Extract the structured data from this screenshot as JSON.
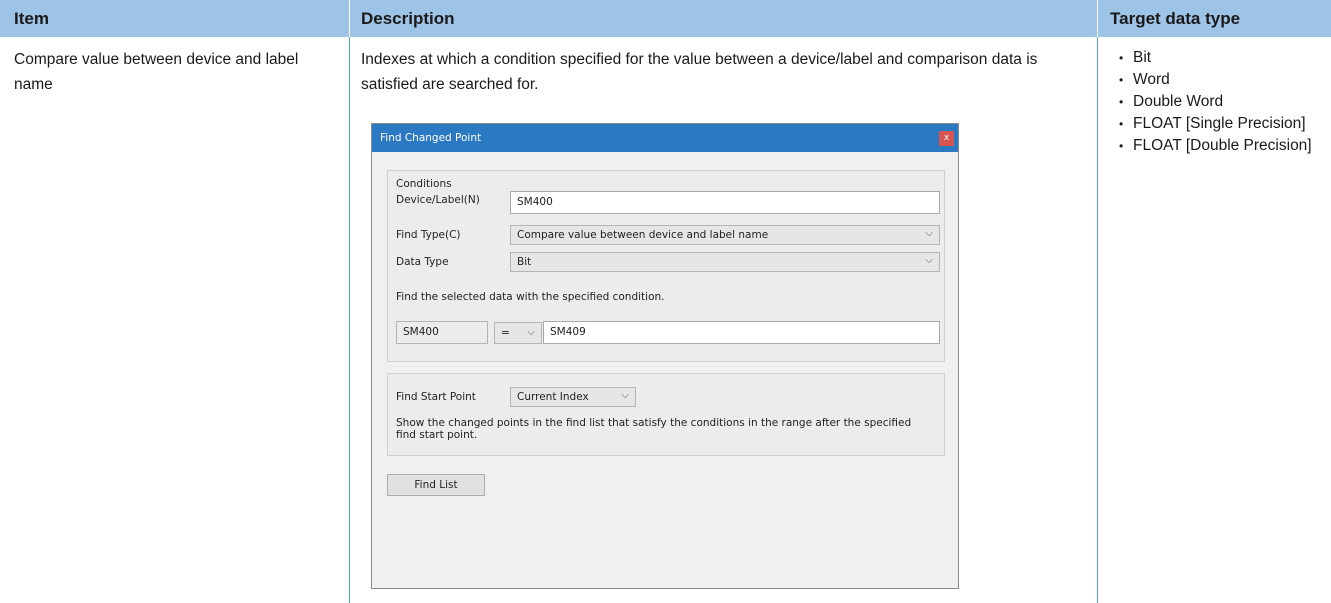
{
  "table": {
    "headers": [
      "Item",
      "Description",
      "Target data type"
    ],
    "row": {
      "item": "Compare value between device and label name",
      "description": "Indexes at which a condition specified for the value between a device/label and comparison data is satisfied are searched for.",
      "target_types": [
        "Bit",
        "Word",
        "Double Word",
        "FLOAT [Single Precision]",
        "FLOAT [Double Precision]"
      ]
    }
  },
  "dialog": {
    "title": "Find Changed Point",
    "close_label": "x",
    "conditions_label": "Conditions",
    "device_label": "Device/Label(N)",
    "device_value": "SM400",
    "find_type_label": "Find Type(C)",
    "find_type_value": "Compare value between device and label name",
    "data_type_label": "Data Type",
    "data_type_value": "Bit",
    "instruction": "Find the selected data with the specified condition.",
    "left_operand": "SM400",
    "operator": "=",
    "right_operand": "SM409",
    "find_start_label": "Find Start Point",
    "find_start_value": "Current Index",
    "note_line1": "Show the changed points in the find list that satisfy the conditions in the range after the specified",
    "note_line2": "find start point.",
    "find_list_button": "Find List"
  },
  "colors": {
    "header_bg": "#9dc3e6",
    "border": "#5b9bd5",
    "titlebar": "#2b79c2"
  }
}
